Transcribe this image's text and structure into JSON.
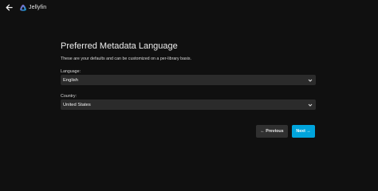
{
  "header": {
    "back_icon": "arrow-left-icon",
    "logo_icon": "jellyfin-logo-icon",
    "app_name": "Jellyfin"
  },
  "wizard": {
    "title": "Preferred Metadata Language",
    "description": "These are your defaults and can be customized on a per-library basis.",
    "language_label": "Language:",
    "language_value": "English",
    "country_label": "Country:",
    "country_value": "United States",
    "previous_label": "← Previous",
    "next_label": "Next →"
  },
  "colors": {
    "background": "#101010",
    "field_bg": "#2b2b2b",
    "accent": "#00a4dc",
    "secondary_button": "#303030",
    "logo_gradient_start": "#aa5cc3",
    "logo_gradient_end": "#00a4dc"
  }
}
